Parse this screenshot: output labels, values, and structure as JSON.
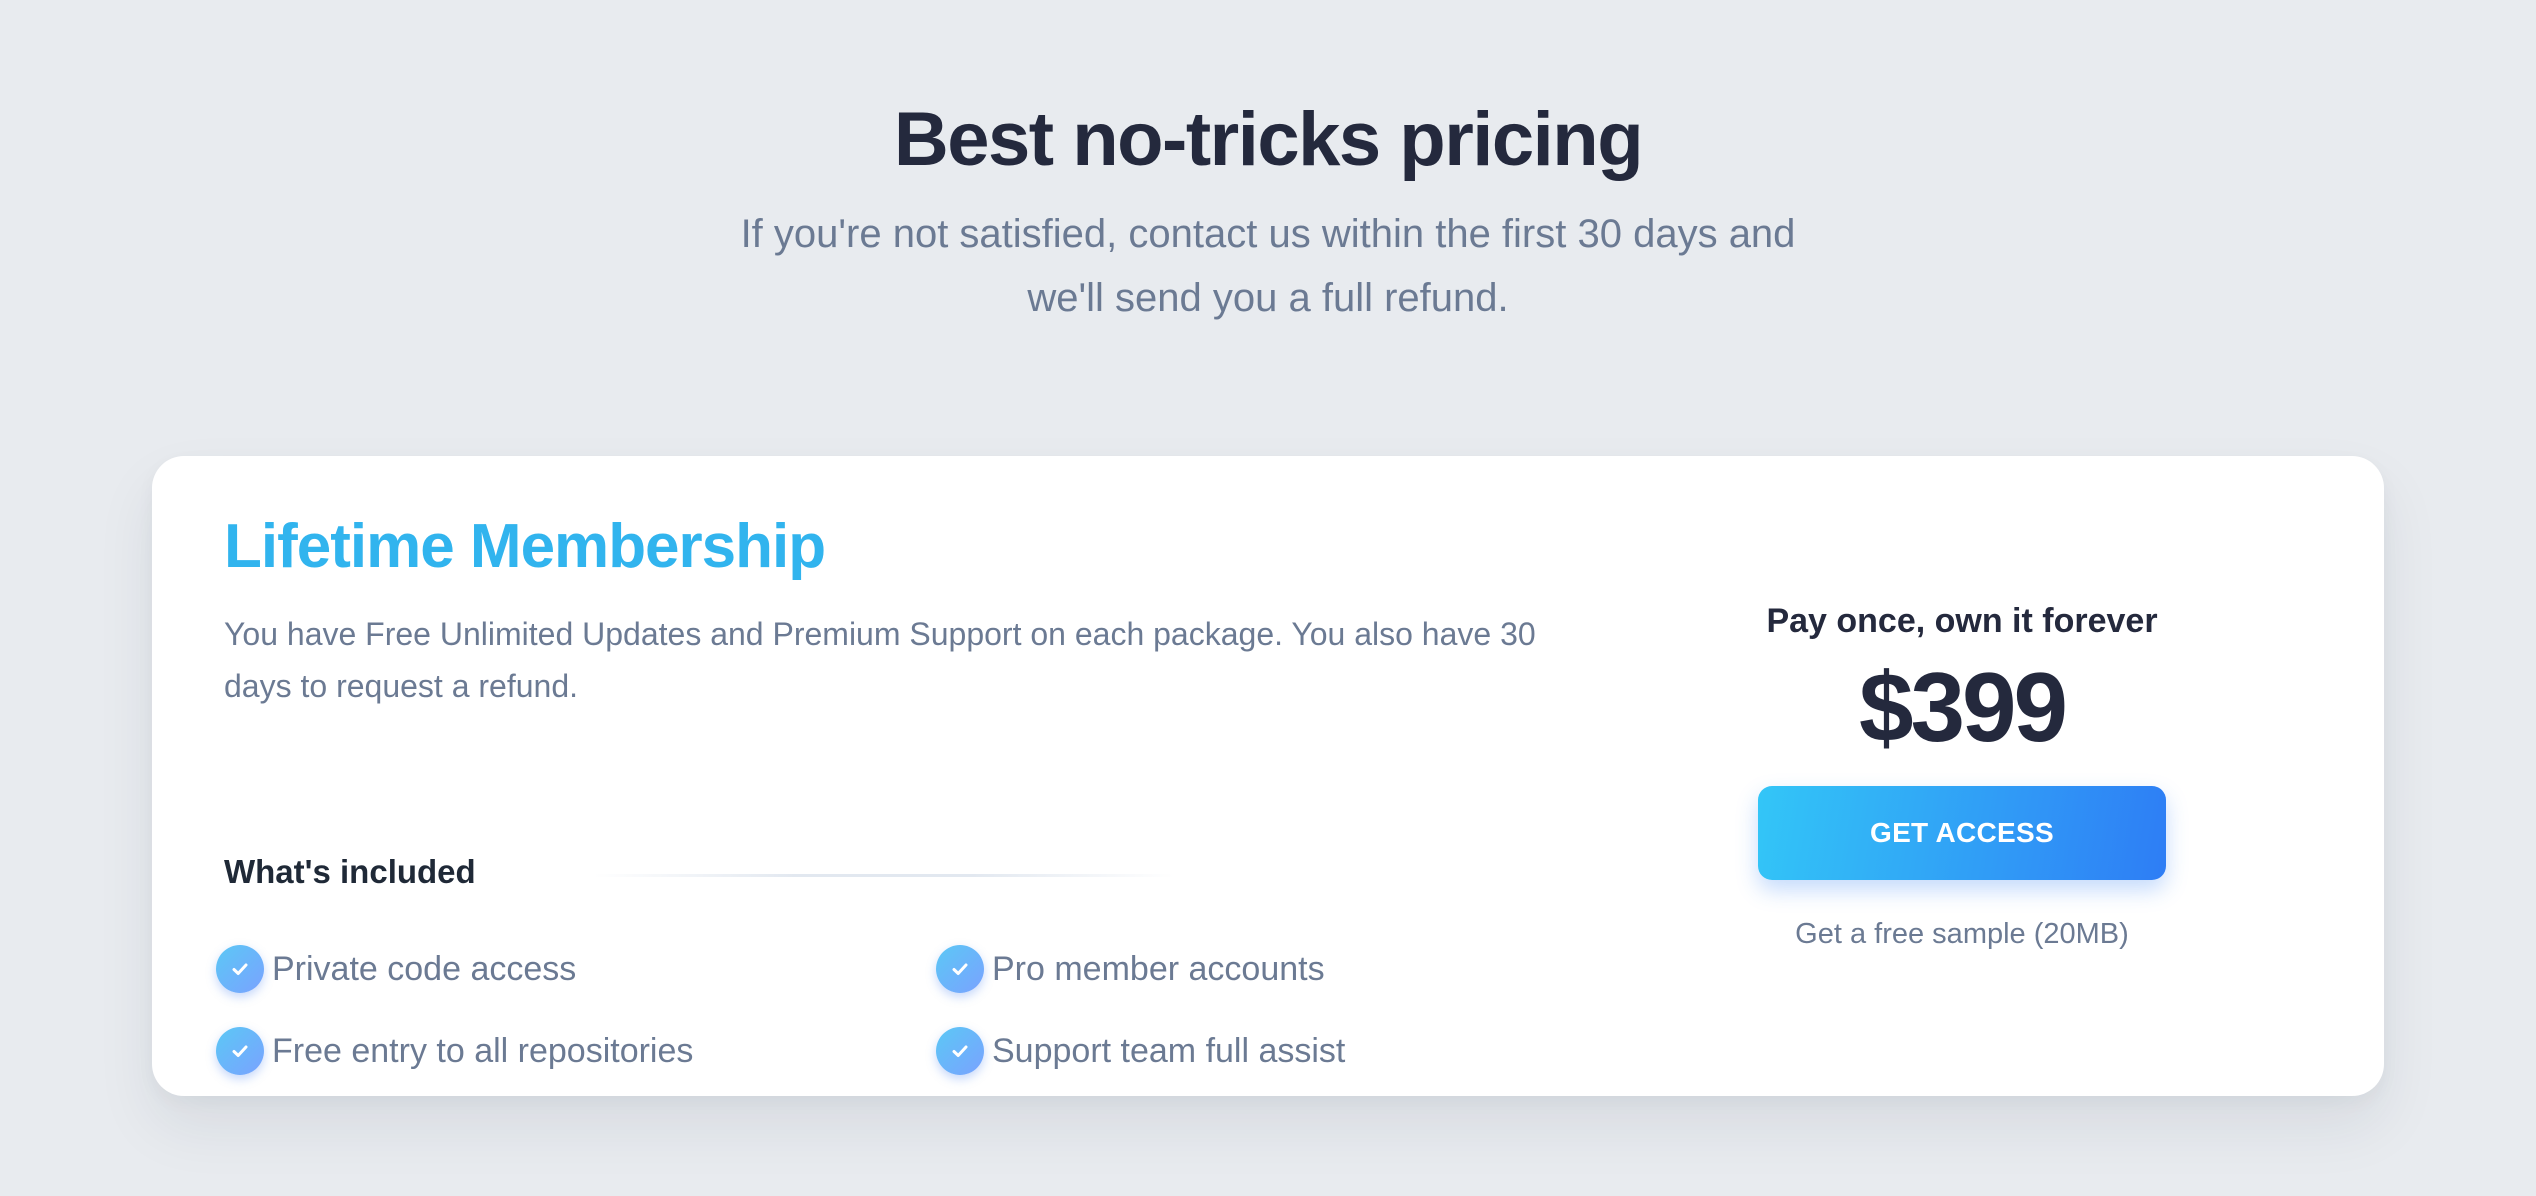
{
  "header": {
    "title": "Best no-tricks pricing",
    "subtitle": "If you're not satisfied, contact us within the first 30 days and we'll send you a full refund."
  },
  "plan": {
    "name": "Lifetime Membership",
    "description": "You have Free Unlimited Updates and Premium Support on each package. You also have 30 days to request a refund.",
    "included_label": "What's included",
    "features": [
      "Private code access",
      "Pro member accounts",
      "Free entry to all repositories",
      "Support team full assist"
    ]
  },
  "pricing": {
    "label": "Pay once, own it forever",
    "price": "$399",
    "cta_label": "GET ACCESS",
    "sample_link": "Get a free sample (20MB)"
  },
  "colors": {
    "background": "#e8ebef",
    "accent_blue": "#31b4ee",
    "button_gradient_start": "#33c6f7",
    "button_gradient_end": "#2e7df5",
    "heading": "#24293d",
    "muted_text": "#6b7a93"
  },
  "icons": {
    "feature_bullet": "check-icon"
  }
}
